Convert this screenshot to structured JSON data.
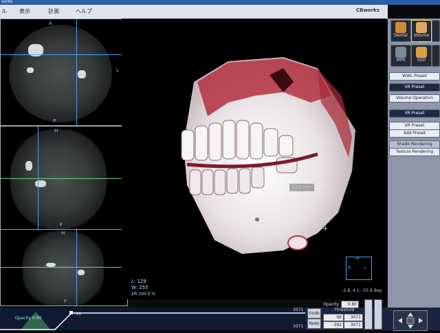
{
  "titlebar": {
    "text": "vorks"
  },
  "menu": {
    "items": [
      "ル",
      "表示",
      "計測",
      "ヘルプ"
    ],
    "brand": "CBworks"
  },
  "axial": {
    "top_label": "A",
    "right_label": "L",
    "bottom_label": "P"
  },
  "sagittal": {
    "top_label": "H",
    "right_label": "P",
    "bottom_label": "F"
  },
  "coronal": {
    "top_label": "H",
    "right_label": "L",
    "bottom_label": "F"
  },
  "view3d": {
    "measurement": "11.1 mm",
    "level": "L: 128",
    "width": "W: 255",
    "zoom": "ZR 100.0 %",
    "angles": "-2.8, 4.1, -55.6 deg",
    "orient_labels": [
      "H",
      "A",
      "L"
    ]
  },
  "right_panel": {
    "modes": [
      {
        "label": "Dental",
        "icon": "tooth-icon",
        "color": "#d08a3a"
      },
      {
        "label": "Volume",
        "icon": "skull-icon",
        "color": "#e0a85a"
      },
      {
        "label": "MPR",
        "icon": "mpr-icon",
        "color": "#7a8a9a"
      },
      {
        "label": "SSD",
        "icon": "ssd-icon",
        "color": "#d9a04a"
      }
    ],
    "wwl_preset": "WWL Preset",
    "vr_preset_tab": "VR Preset",
    "volume_operation": "Volume Operation",
    "vr_preset_header": "VR Preset",
    "vr_preset_btn": "VR Preset",
    "add_preset": "Add Preset",
    "shade_rendering": "Shade Rendering",
    "texture_rendering": "Texture Rendering"
  },
  "bottom": {
    "opacity_label": "Opacity 0.80",
    "curve_value": "99",
    "curve_max_top": "3071",
    "curve_max_bottom": "3071",
    "undo": "Undo",
    "redo": "Redo",
    "opacity_title": "Opacity",
    "opacity_value": "0.80",
    "threshold_title": "Threshold",
    "threshold_low1": "99",
    "threshold_high1": "3071",
    "threshold_low2": "-392",
    "threshold_high2": "3071"
  },
  "colors": {
    "accent": "#2a5fa8",
    "measure_line": "#4aa3ff",
    "tissue": "#b43040"
  }
}
